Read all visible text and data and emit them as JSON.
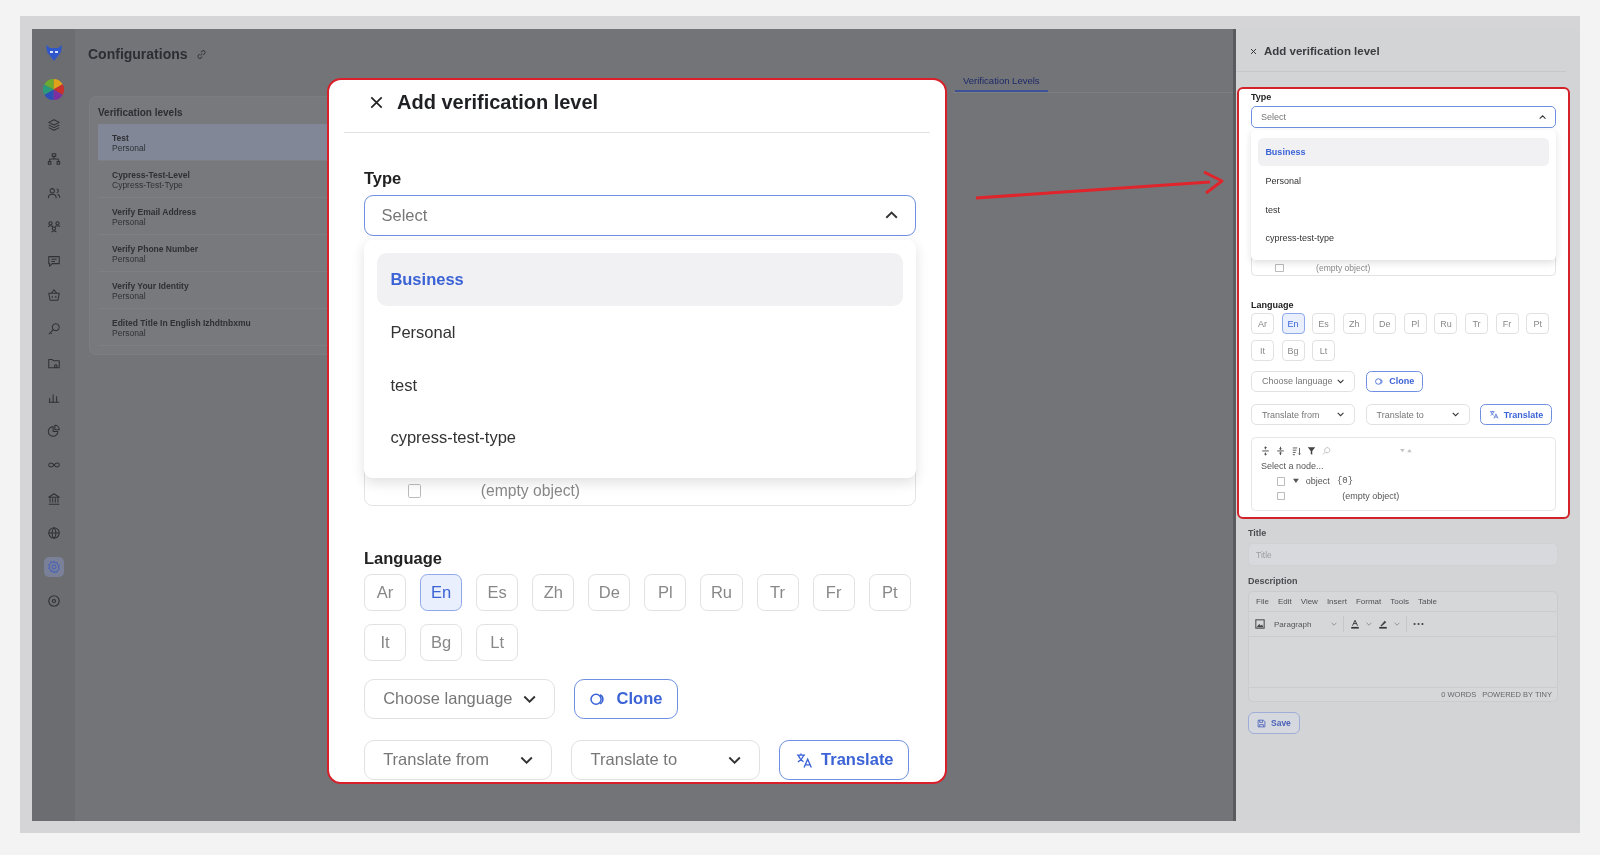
{
  "sidebar": {
    "items": [
      {
        "selected": false
      },
      {
        "selected": false
      },
      {
        "selected": false
      },
      {
        "selected": false
      },
      {
        "selected": false
      },
      {
        "selected": false
      },
      {
        "selected": false
      },
      {
        "selected": false
      },
      {
        "selected": false
      },
      {
        "selected": false
      },
      {
        "selected": false
      },
      {
        "selected": false
      },
      {
        "selected": false
      },
      {
        "selected": true
      },
      {
        "selected": false
      }
    ]
  },
  "header": {
    "title": "Configurations"
  },
  "tabs": [
    {
      "label": "Verification Levels",
      "selected": true
    }
  ],
  "levels": {
    "title": "Verification levels",
    "items": [
      {
        "title": "Test",
        "subtitle": "Personal",
        "selected": true
      },
      {
        "title": "Cypress-Test-Level",
        "subtitle": "Cypress-Test-Type",
        "selected": false
      },
      {
        "title": "Verify Email Address",
        "subtitle": "Personal",
        "selected": false
      },
      {
        "title": "Verify Phone Number",
        "subtitle": "Personal",
        "selected": false
      },
      {
        "title": "Verify Your Identity",
        "subtitle": "Personal",
        "selected": false
      },
      {
        "title": "Edited Title In English Izhdtnbxmu",
        "subtitle": "Personal",
        "selected": false
      }
    ]
  },
  "callout": {
    "title": "Add verification level",
    "form": {
      "type": {
        "label": "Type",
        "placeholder": "Select",
        "expanded": true,
        "options": [
          {
            "label": "Business",
            "selected": true
          },
          {
            "label": "Personal",
            "selected": false
          },
          {
            "label": "test",
            "selected": false
          },
          {
            "label": "cypress-test-type",
            "selected": false
          }
        ]
      },
      "covered_row": {
        "text": "(empty object)",
        "checked": false
      },
      "language": {
        "label": "Language",
        "chips": [
          {
            "label": "Ar",
            "selected": false
          },
          {
            "label": "En",
            "selected": true
          },
          {
            "label": "Es",
            "selected": false
          },
          {
            "label": "Zh",
            "selected": false
          },
          {
            "label": "De",
            "selected": false
          },
          {
            "label": "Pl",
            "selected": false
          },
          {
            "label": "Ru",
            "selected": false
          },
          {
            "label": "Tr",
            "selected": false
          },
          {
            "label": "Fr",
            "selected": false
          },
          {
            "label": "Pt",
            "selected": false
          },
          {
            "label": "It",
            "selected": false
          },
          {
            "label": "Bg",
            "selected": false
          },
          {
            "label": "Lt",
            "selected": false
          }
        ]
      },
      "choose_language": "Choose language",
      "clone": "Clone",
      "translate_from": "Translate from",
      "translate_to": "Translate to",
      "translate": "Translate"
    }
  },
  "drawer": {
    "title": "Add verification level",
    "form": {
      "type": {
        "label": "Type",
        "placeholder": "Select",
        "expanded": true,
        "options": [
          {
            "label": "Business",
            "selected": true
          },
          {
            "label": "Personal",
            "selected": false
          },
          {
            "label": "test",
            "selected": false
          },
          {
            "label": "cypress-test-type",
            "selected": false
          }
        ]
      },
      "covered_row": {
        "text": "(empty object)",
        "checked": false
      },
      "language": {
        "label": "Language",
        "chips": [
          {
            "label": "Ar",
            "selected": false
          },
          {
            "label": "En",
            "selected": true
          },
          {
            "label": "Es",
            "selected": false
          },
          {
            "label": "Zh",
            "selected": false
          },
          {
            "label": "De",
            "selected": false
          },
          {
            "label": "Pl",
            "selected": false
          },
          {
            "label": "Ru",
            "selected": false
          },
          {
            "label": "Tr",
            "selected": false
          },
          {
            "label": "Fr",
            "selected": false
          },
          {
            "label": "Pt",
            "selected": false
          },
          {
            "label": "It",
            "selected": false
          },
          {
            "label": "Bg",
            "selected": false
          },
          {
            "label": "Lt",
            "selected": false
          }
        ]
      },
      "choose_language": "Choose language",
      "clone": "Clone",
      "translate_from": "Translate from",
      "translate_to": "Translate to",
      "translate": "Translate",
      "json_editor": {
        "path": "Select a node...",
        "nodes": [
          {
            "label": "object",
            "count": "{0}",
            "checked": false,
            "expanded": true,
            "children": [
              {
                "label": "(empty object)",
                "checked": false
              }
            ]
          }
        ]
      }
    },
    "title_field": {
      "label": "Title",
      "placeholder": "Title"
    },
    "description": {
      "label": "Description",
      "menu": [
        "File",
        "Edit",
        "View",
        "Insert",
        "Format",
        "Tools",
        "Table"
      ],
      "block_format": "Paragraph",
      "word_count": "0 WORDS",
      "powered_by": "POWERED BY TINY"
    },
    "save": "Save"
  }
}
